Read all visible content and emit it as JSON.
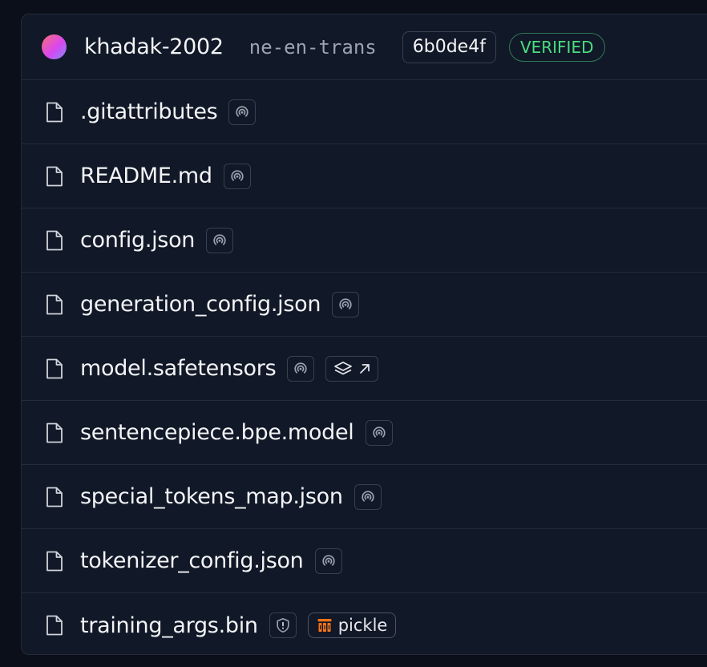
{
  "header": {
    "owner": "khadak-2002",
    "repo": "ne-en-trans",
    "commit": "6b0de4f",
    "verified": "VERIFIED"
  },
  "files": [
    {
      "name": ".gitattributes",
      "badges": [
        "xet-icon"
      ]
    },
    {
      "name": "README.md",
      "badges": [
        "xet-icon"
      ]
    },
    {
      "name": "config.json",
      "badges": [
        "xet-icon"
      ]
    },
    {
      "name": "generation_config.json",
      "badges": [
        "xet-icon"
      ]
    },
    {
      "name": "model.safetensors",
      "badges": [
        "xet-icon",
        "layers-external-link-icon"
      ]
    },
    {
      "name": "sentencepiece.bpe.model",
      "badges": [
        "xet-icon"
      ]
    },
    {
      "name": "special_tokens_map.json",
      "badges": [
        "xet-icon"
      ]
    },
    {
      "name": "tokenizer_config.json",
      "badges": [
        "xet-icon"
      ]
    },
    {
      "name": "training_args.bin",
      "badges": [
        "shield-warning-icon",
        "pickle-icon"
      ]
    }
  ],
  "pickle_label": "pickle",
  "colors": {
    "background": "#0b0f19",
    "panel": "#111827",
    "border": "#252b38",
    "verified": "#4ade80",
    "pickle_accent": "#f97316"
  }
}
